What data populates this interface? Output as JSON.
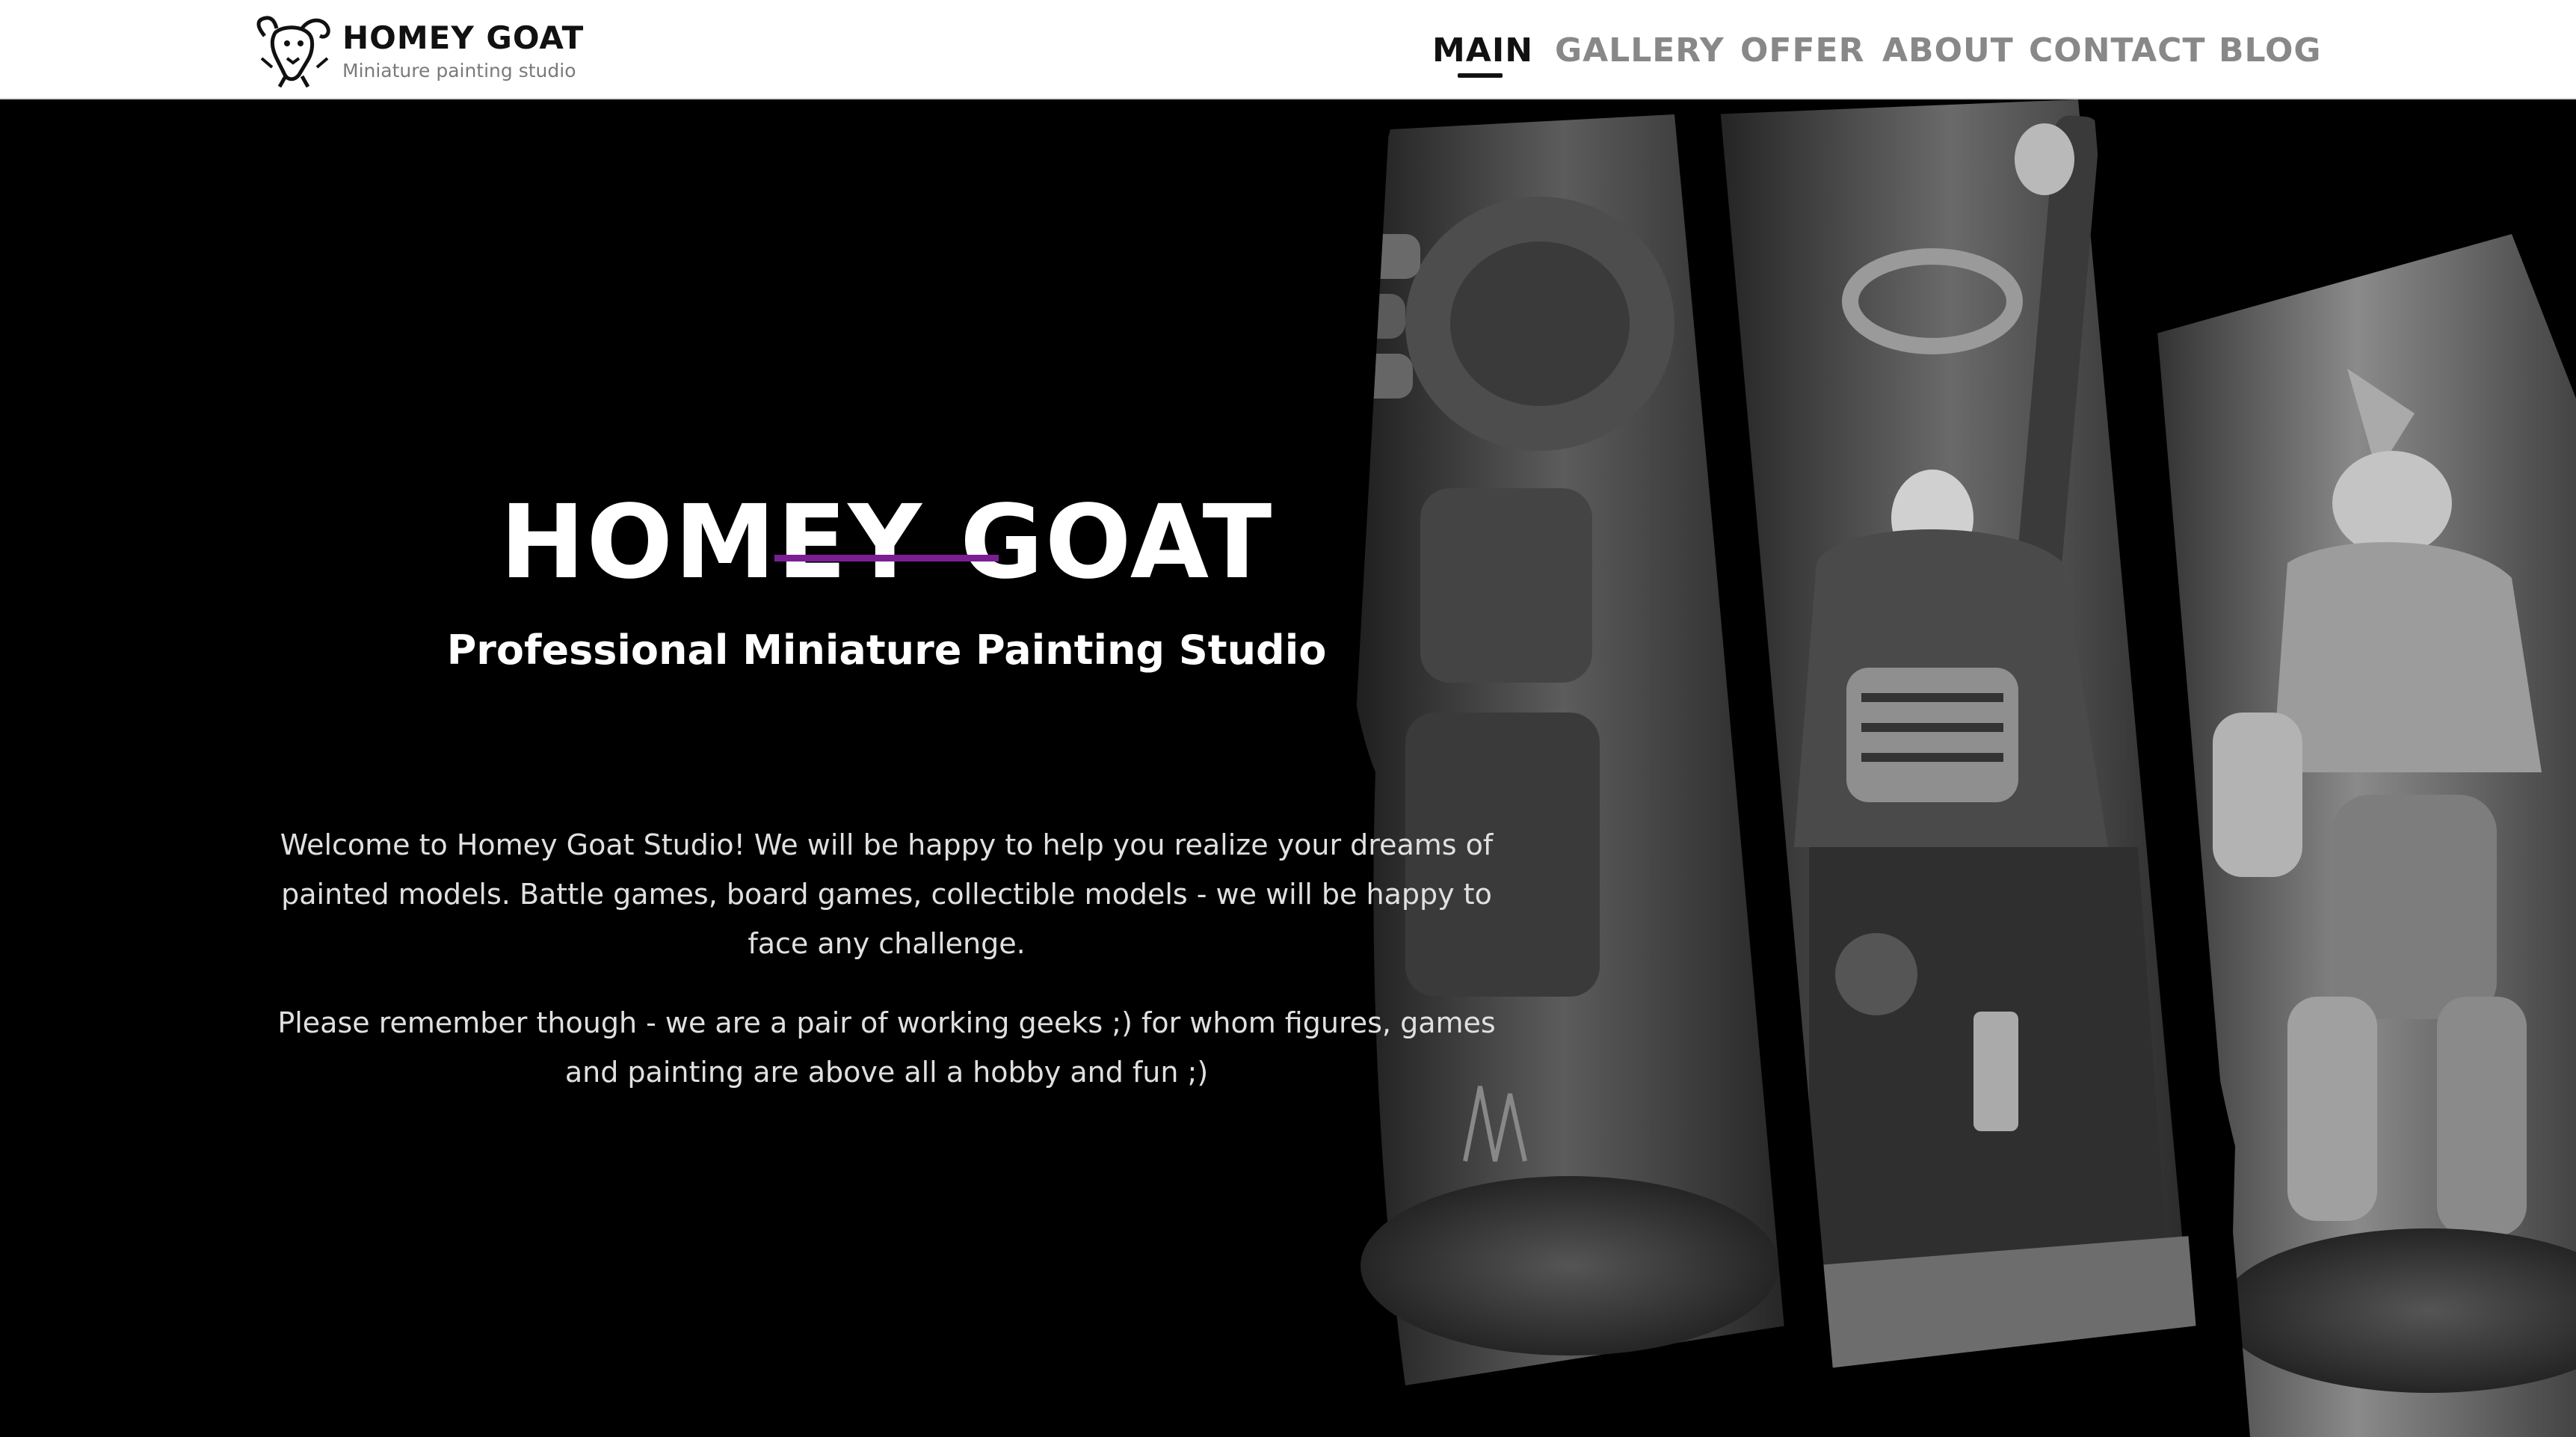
{
  "brand": {
    "title": "HOMEY GOAT",
    "subtitle": "Miniature painting studio",
    "icon": "goat-head-logo"
  },
  "nav": {
    "items": [
      {
        "label": "MAIN",
        "active": true
      },
      {
        "label": "GALLERY",
        "active": false
      },
      {
        "label": "OFFER",
        "active": false
      },
      {
        "label": "ABOUT",
        "active": false
      },
      {
        "label": "CONTACT",
        "active": false
      },
      {
        "label": "BLOG",
        "active": false
      }
    ]
  },
  "hero": {
    "title": "HOMEY GOAT",
    "subtitle": "Professional Miniature Painting Studio",
    "paragraphs": [
      "Welcome to Homey Goat Studio! We will be happy to help you realize your dreams of painted models. Battle games, board games, collectible models - we will be happy to face any challenge.",
      "Please remember though - we are a pair of working geeks ;) for whom figures, games and painting are above all a hobby and fun ;)"
    ],
    "images": [
      "armored-dreadnought-miniature",
      "skull-masked-chaplain-miniature",
      "mech-warrior-miniature"
    ]
  },
  "colors": {
    "accent": "#7a1f93",
    "header_bg": "#ffffff",
    "hero_bg": "#000000",
    "nav_active": "#111111",
    "nav_inactive": "#888888"
  }
}
